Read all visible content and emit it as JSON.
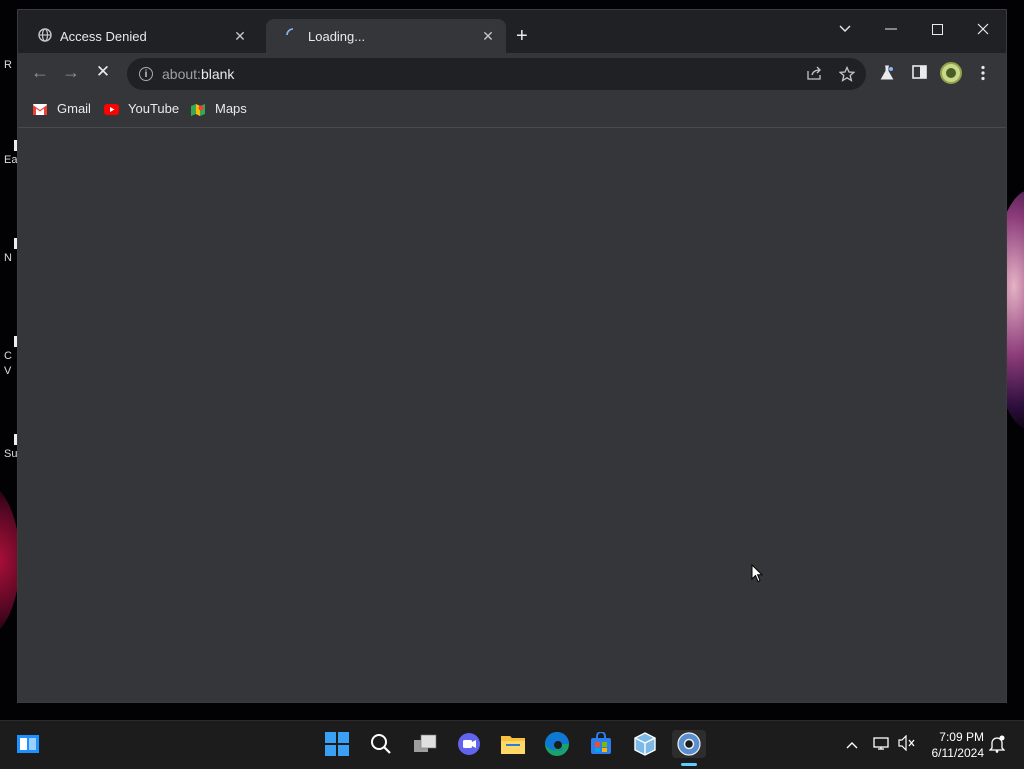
{
  "desktop": {
    "icon_labels": [
      "R",
      "Ea",
      "N",
      "C",
      "V",
      "Su"
    ]
  },
  "tabs": [
    {
      "label": "Access Denied",
      "icon": "globe-icon",
      "active": false
    },
    {
      "label": "Loading...",
      "icon": "spinner-icon",
      "active": true
    }
  ],
  "new_tab": "+",
  "window_controls": {
    "dropdown": "⌵",
    "minimize": "—",
    "maximize": "☐",
    "close": "✕"
  },
  "toolbar": {
    "back": "←",
    "forward": "→",
    "stop": "✕",
    "info": "i",
    "url_prefix": "about:",
    "url_host": "blank"
  },
  "bookmarks": [
    {
      "label": "Gmail",
      "icon": "gmail-icon"
    },
    {
      "label": "YouTube",
      "icon": "youtube-icon"
    },
    {
      "label": "Maps",
      "icon": "maps-icon"
    }
  ],
  "taskbar": {
    "time": "7:09 PM",
    "date": "6/11/2024"
  },
  "colors": {
    "titlebar": "#202124",
    "toolbar": "#35363a",
    "taskbar": "#1c1c1c"
  }
}
